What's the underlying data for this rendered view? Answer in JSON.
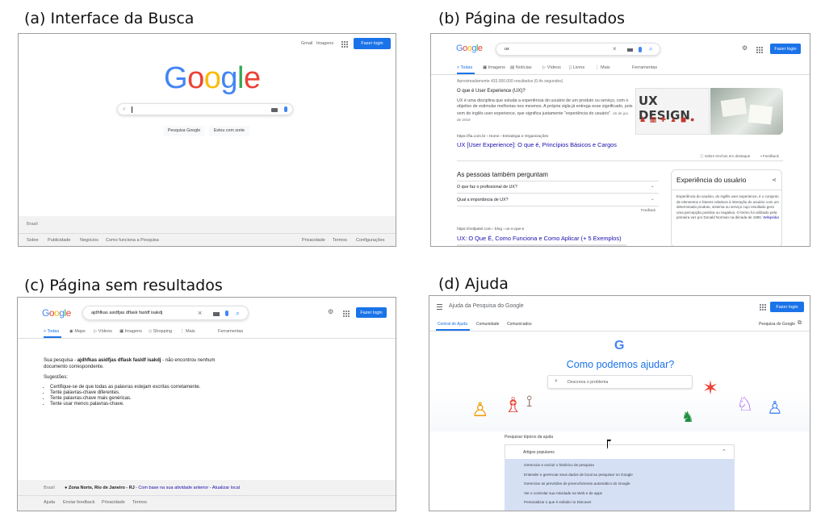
{
  "captions": {
    "a": "(a) Interface da Busca",
    "b": "(b) Página de resultados",
    "c": "(c) Página sem resultados",
    "d": "(d) Ajuda"
  },
  "colors": {
    "google_blue": "#4285f4",
    "google_red": "#ea4335",
    "google_yellow": "#fbbc05",
    "google_green": "#34a853",
    "button_blue": "#1a73e8",
    "link": "#1a0dab"
  },
  "logo": {
    "l1": "G",
    "l2": "o",
    "l3": "o",
    "l4": "g",
    "l5": "l",
    "l6": "e"
  },
  "panel_a": {
    "header": {
      "gmail": "Gmail",
      "images": "Imagens",
      "login": "Fazer login"
    },
    "search_button": "Pesquisa Google",
    "lucky_button": "Estou com sorte",
    "country": "Brasil",
    "footer_left": [
      "Sobre",
      "Publicidade",
      "Negócios",
      "Como funciona a Pesquisa"
    ],
    "footer_right": [
      "Privacidade",
      "Termos",
      "Configurações"
    ]
  },
  "panel_b": {
    "query": "ux",
    "login": "Fazer login",
    "tabs": [
      "Todas",
      "Imagens",
      "Notícias",
      "Vídeos",
      "Livros",
      "Mais"
    ],
    "tools": "Ferramentas",
    "stats": "Aproximadamente 433.000.000 resultados (0,4s segundos)",
    "question": "O que é User Experience (UX)?",
    "snippet": "UX é uma disciplina que estuda a experiência do usuário de um produto ou serviço, com o objetivo de estimular melhorias nos mesmos. A própria sigla já entrega esse significado, pois vem do inglês user experience, que significa justamente \"experiência do usuário\".",
    "snippet_date": "16 de jun. de 2019",
    "result1_url": "https://fia.com.br › Home › Estratégia e Organizações",
    "result1_title": "UX [User Experience]: O que é, Princípios Básicos e Cargos",
    "image_text": "UX DESIGN",
    "about_snippets": "Sobre trechos em destaque",
    "feedback": "Feedback",
    "paa_title": "As pessoas também perguntam",
    "paa": [
      "O que faz o profissional de UX?",
      "Qual a importância de UX?"
    ],
    "paa_feedback": "Feedback",
    "result2_url": "https://neilpatel.com › blog › ux-o-que-e",
    "result2_title": "UX: O Que É, Como Funciona e Como Aplicar (+ 5 Exemplos)",
    "kp_title": "Experiência do usuário",
    "kp_text": "Experiência do usuário, do inglês user experience, é o conjunto de elementos e fatores relativos à interação do usuário com um determinado produto, sistema ou serviço cujo resultado gera uma percepção positiva ou negativa. O termo foi utilizado pela primeira vez por Donald Norman na década de 1990.",
    "kp_source": "Wikipédia"
  },
  "panel_c": {
    "query": "ajdhfkas asidfjas dflask fasldf isakdj",
    "login": "Fazer login",
    "tabs": [
      "Todas",
      "Maps",
      "Vídeos",
      "Imagens",
      "Shopping",
      "Mais"
    ],
    "tools": "Ferramentas",
    "msg_prefix": "Sua pesquisa - ",
    "msg_query": "ajdhfkas asidfjas dflask fasldf isakdj",
    "msg_suffix": " - não encontrou nenhum documento correspondente.",
    "suggest_title": "Sugestões:",
    "suggestions": [
      "Certifique-se de que todas as palavras estejam escritas corretamente.",
      "Tente palavras-chave diferentes.",
      "Tente palavras-chave mais genéricas.",
      "Tente usar menos palavras-chave."
    ],
    "country": "Brasil",
    "location": "Zona Norte, Rio de Janeiro - RJ",
    "location_link": "Com base na sua atividade anterior",
    "update_link": "Atualizar local",
    "footer": [
      "Ajuda",
      "Enviar feedback",
      "Privacidade",
      "Termos"
    ]
  },
  "panel_d": {
    "title": "Ajuda da Pesquisa do Google",
    "login": "Fazer login",
    "tabs": [
      "Central de Ajuda",
      "Comunidade",
      "Comunicados"
    ],
    "right_link": "Pesquisa do Google",
    "heading": "Como podemos ajudar?",
    "search_placeholder": "Descreva o problema",
    "topics_title": "Pesquisar tópicos da ajuda",
    "dropdown": "Artigos populares",
    "items": [
      "Gerenciar e excluir o histórico de pesquisa",
      "Entender e gerenciar seus dados de local ao pesquisar no Google",
      "Gerenciar as previsões de preenchimento automático do Google",
      "Ver e controlar sua Atividade na Web e de apps",
      "Personalizar o que é exibido no Discover"
    ]
  }
}
